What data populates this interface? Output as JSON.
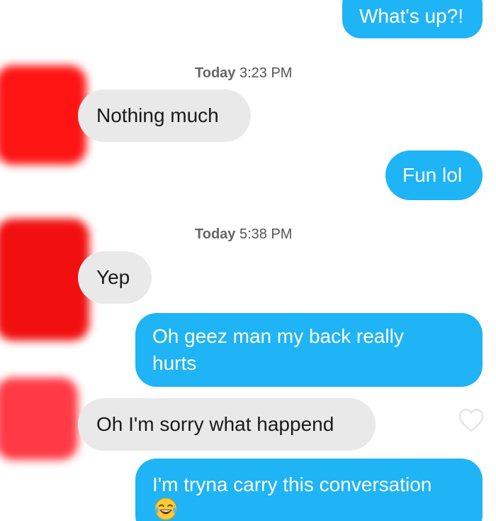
{
  "messages": [
    {
      "id": "m1",
      "direction": "sent",
      "text": "What's up?!"
    },
    {
      "id": "m2",
      "direction": "received",
      "timestamp_day": "Today",
      "timestamp_time": "3:23 PM",
      "text": "Nothing much"
    },
    {
      "id": "m3",
      "direction": "sent",
      "text": "Fun lol"
    },
    {
      "id": "m4",
      "direction": "received",
      "timestamp_day": "Today",
      "timestamp_time": "5:38 PM",
      "text": "Yep"
    },
    {
      "id": "m5",
      "direction": "sent",
      "text_line1": "Oh geez man my back really",
      "text_line2": "hurts"
    },
    {
      "id": "m6",
      "direction": "received",
      "text": "Oh I'm sorry what happend",
      "like_icon": "heart-outline-icon"
    },
    {
      "id": "m7",
      "direction": "sent",
      "text": "I'm tryna carry this conversation",
      "emoji": "😂",
      "emoji_name": "face-with-tears-of-joy-emoji"
    }
  ],
  "colors": {
    "sent_bubble": "#1fb4f5",
    "received_bubble": "#e9e9e9",
    "avatar_censor": "#ff1a1a"
  }
}
